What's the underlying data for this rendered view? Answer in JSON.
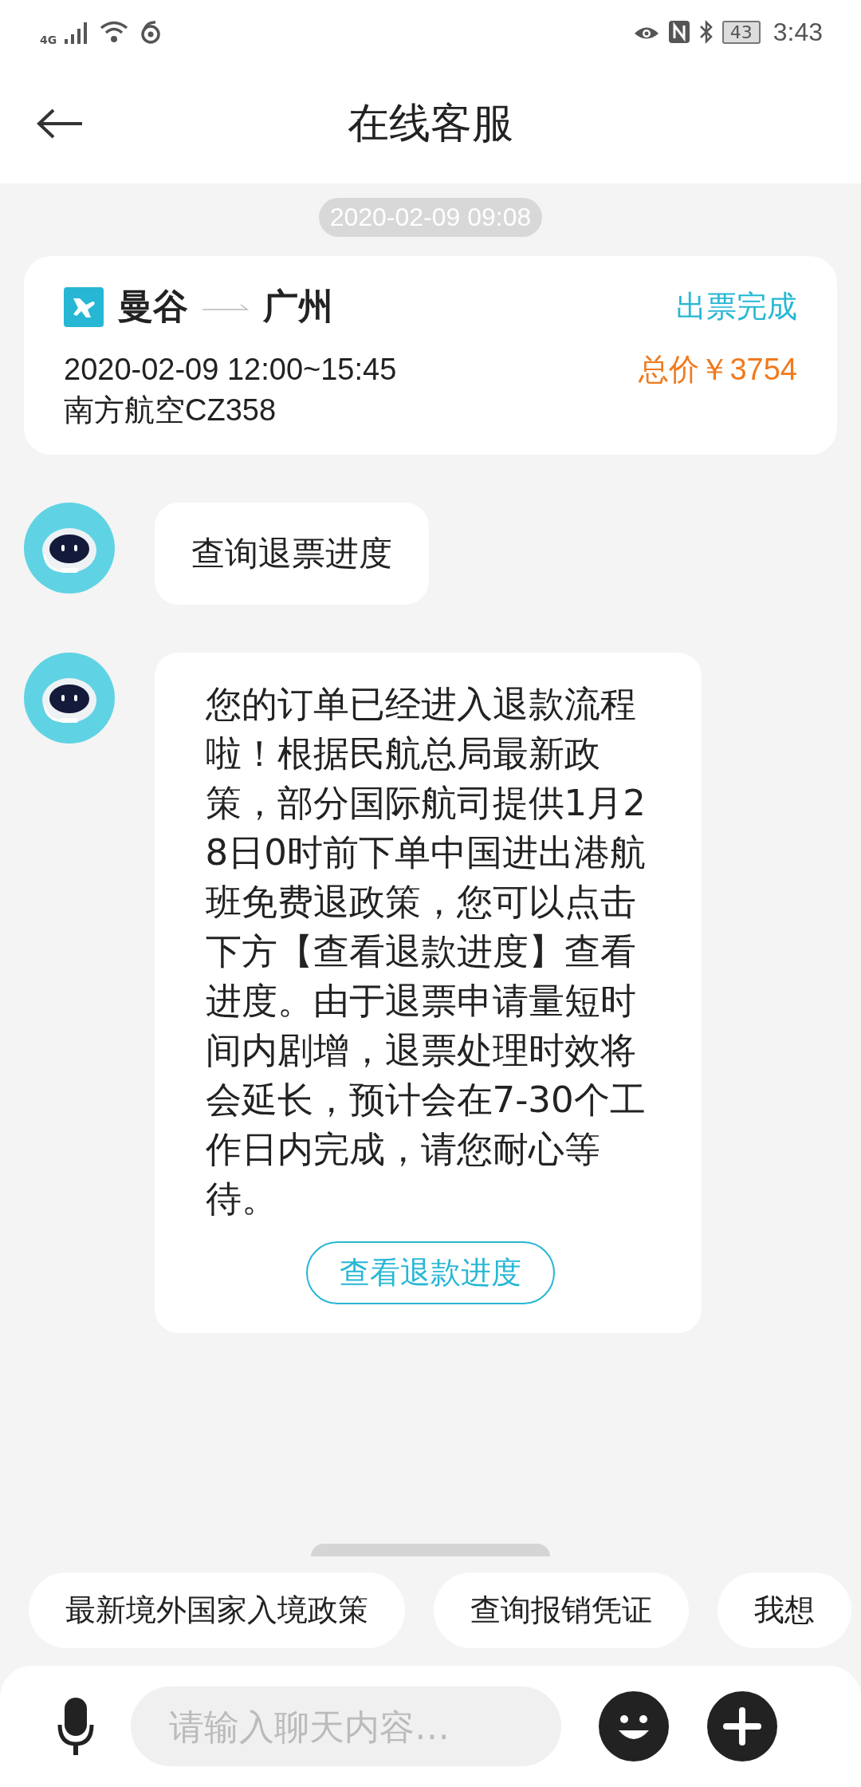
{
  "status_bar": {
    "network": "4G",
    "battery": "43",
    "time": "3:43"
  },
  "header": {
    "title": "在线客服"
  },
  "timestamp": "2020-02-09 09:08",
  "order_card": {
    "from": "曼谷",
    "to": "广州",
    "status": "出票完成",
    "datetime": "2020-02-09 12:00~15:45",
    "price": "总价￥3754",
    "flight": "南方航空CZ358"
  },
  "messages": [
    {
      "kind": "text",
      "text": "查询退票进度"
    },
    {
      "kind": "text_with_button",
      "text": "您的订单已经进入退款流程啦！根据民航总局最新政策，部分国际航司提供1月28日0时前下单中国进出港航班免费退政策，您可以点击下方【查看退款进度】查看进度。由于退票申请量短时间内剧增，退票处理时效将会延长，预计会在7-30个工作日内完成，请您耐心等待。",
      "button": "查看退款进度"
    }
  ],
  "quick_replies": [
    "最新境外国家入境政策",
    "查询报销凭证",
    "我想"
  ],
  "input": {
    "placeholder": "请输入聊天内容…"
  }
}
